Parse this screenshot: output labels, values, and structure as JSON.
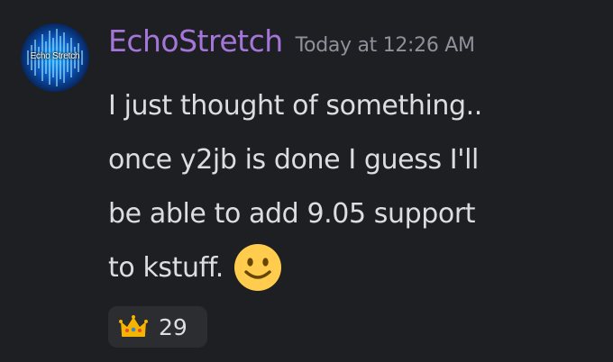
{
  "author": {
    "username": "EchoStretch",
    "avatar_text": "Echo Stretch",
    "username_color": "#a576d9"
  },
  "message": {
    "timestamp": "Today at 12:26 AM",
    "lines": [
      "I just thought of something..",
      "once y2jb is done I guess I'll",
      "be able to add 9.05 support",
      "to kstuff."
    ],
    "trailing_emoji": "slightly-smiling-face-icon"
  },
  "reactions": [
    {
      "emoji": "crown-icon",
      "count": "29"
    }
  ],
  "colors": {
    "background": "#1e1f22",
    "text": "#dbdee1",
    "timestamp": "#8e9199",
    "reaction_bg": "#2b2d31"
  }
}
